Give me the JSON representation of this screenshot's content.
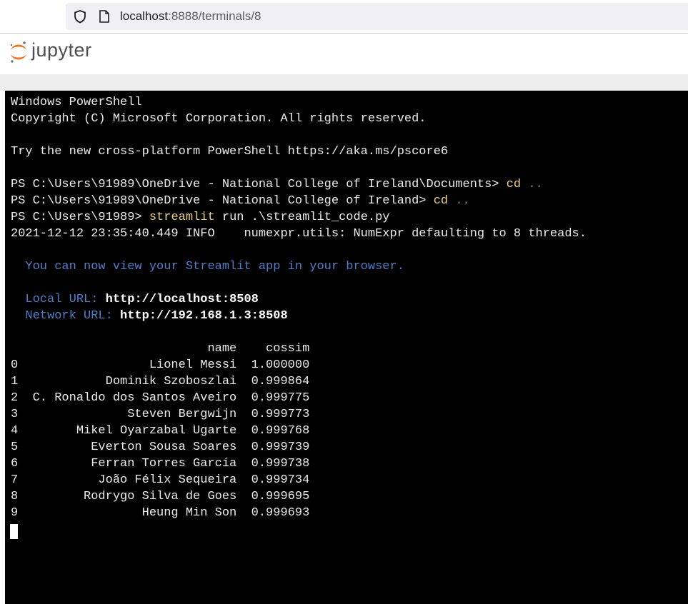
{
  "browser": {
    "url_host": "localhost",
    "url_rest": ":8888/terminals/8",
    "icons": [
      "shield-icon",
      "page-icon"
    ]
  },
  "jupyter": {
    "logo_text": "jupyter",
    "logo_icon": "jupyter-logo-icon",
    "colors": {
      "logo_orange": "#f37626",
      "logo_gray": "#767677"
    }
  },
  "terminal": {
    "banner_title": "Windows PowerShell",
    "banner_copyright": "Copyright (C) Microsoft Corporation. All rights reserved.",
    "banner_try": "Try the new cross-platform PowerShell https://aka.ms/pscore6",
    "cmd1": {
      "prompt": "PS C:\\Users\\91989\\OneDrive - National College of Ireland\\Documents>",
      "command": "cd",
      "args": ".."
    },
    "cmd2": {
      "prompt": "PS C:\\Users\\91989\\OneDrive - National College of Ireland>",
      "command": "cd",
      "args": ".."
    },
    "cmd3": {
      "prompt": "PS C:\\Users\\91989>",
      "command": "streamlit",
      "args": "run .\\streamlit_code.py"
    },
    "log_line": "2021-12-12 23:35:40.449 INFO    numexpr.utils: NumExpr defaulting to 8 threads.",
    "view_msg": "You can now view your Streamlit app in your browser.",
    "local_label": "Local URL:",
    "local_url": "http://localhost:8508",
    "network_label": "Network URL:",
    "network_url": "http://192.168.1.3:8508",
    "table": {
      "columns": [
        "name",
        "cossim"
      ],
      "rows": [
        [
          "0",
          "Lionel Messi",
          "1.000000"
        ],
        [
          "1",
          "Dominik Szoboszlai",
          "0.999864"
        ],
        [
          "2",
          "C. Ronaldo dos Santos Aveiro",
          "0.999775"
        ],
        [
          "3",
          "Steven Bergwijn",
          "0.999773"
        ],
        [
          "4",
          "Mikel Oyarzabal Ugarte",
          "0.999768"
        ],
        [
          "5",
          "Everton Sousa Soares",
          "0.999739"
        ],
        [
          "6",
          "Ferran Torres García",
          "0.999738"
        ],
        [
          "7",
          "João Félix Sequeira",
          "0.999734"
        ],
        [
          "8",
          "Rodrygo Silva de Goes",
          "0.999695"
        ],
        [
          "9",
          "Heung Min Son",
          "0.999693"
        ]
      ]
    },
    "colors": {
      "background": "#000000",
      "text": "#ececec",
      "command": "#e8d27a",
      "info": "#4f7fc9"
    }
  }
}
